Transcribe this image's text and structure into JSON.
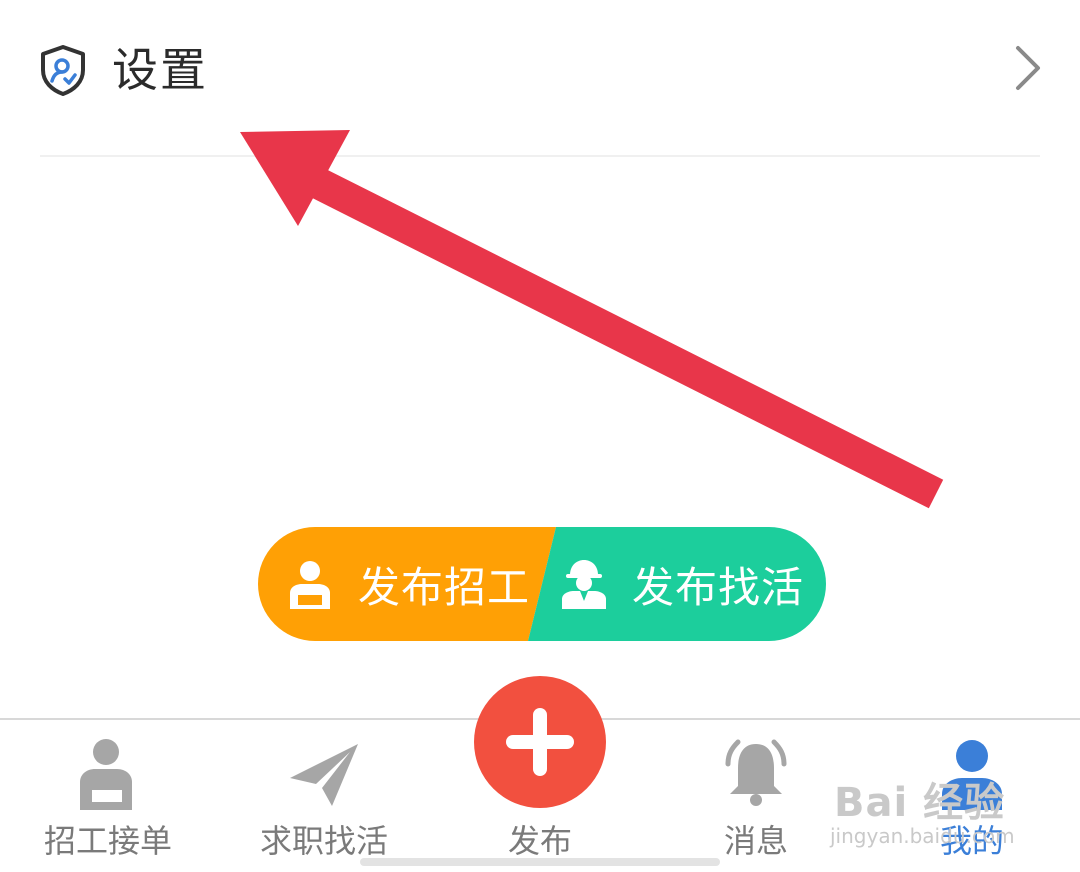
{
  "settings": {
    "label": "设置",
    "icon": "shield-user-icon",
    "chevron": "chevron-right-icon"
  },
  "publish_menu": {
    "recruit": {
      "label": "发布招工",
      "icon": "worker-icon",
      "color": "#FFA005"
    },
    "find_work": {
      "label": "发布找活",
      "icon": "helmet-worker-icon",
      "color": "#1CCE9C"
    }
  },
  "fab": {
    "icon": "plus-icon",
    "color": "#F2503F"
  },
  "tabbar": {
    "items": [
      {
        "label": "招工接单",
        "icon": "worker-desk-icon",
        "active": false
      },
      {
        "label": "求职找活",
        "icon": "paper-plane-icon",
        "active": false
      },
      {
        "label": "发布",
        "icon": "plus-icon",
        "active": false
      },
      {
        "label": "消息",
        "icon": "bell-icon",
        "active": false
      },
      {
        "label": "我的",
        "icon": "user-icon",
        "active": true
      }
    ]
  },
  "watermark": {
    "main": "Bai 经验",
    "sub": "jingyan.baidu.com"
  },
  "colors": {
    "accent": "#3B7FD8",
    "inactive": "#7A7A7A",
    "arrow": "#E8364A"
  }
}
